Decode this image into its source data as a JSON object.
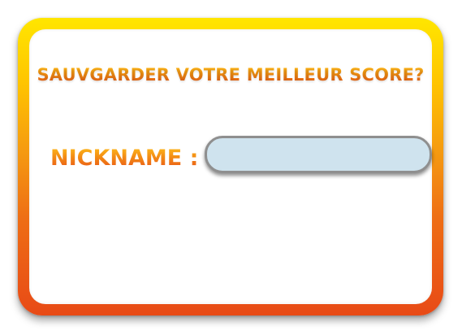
{
  "dialog": {
    "title": "SAUVGARDER VOTRE MEILLEUR SCORE?",
    "nickname_label": "NICKNAME :",
    "nickname_value": ""
  },
  "colors": {
    "frame_top": "#ffe600",
    "frame_bottom": "#e84a16",
    "text_orange": "#f07c12",
    "input_fill": "#cfe3ee",
    "input_border": "#8f8f8f"
  }
}
